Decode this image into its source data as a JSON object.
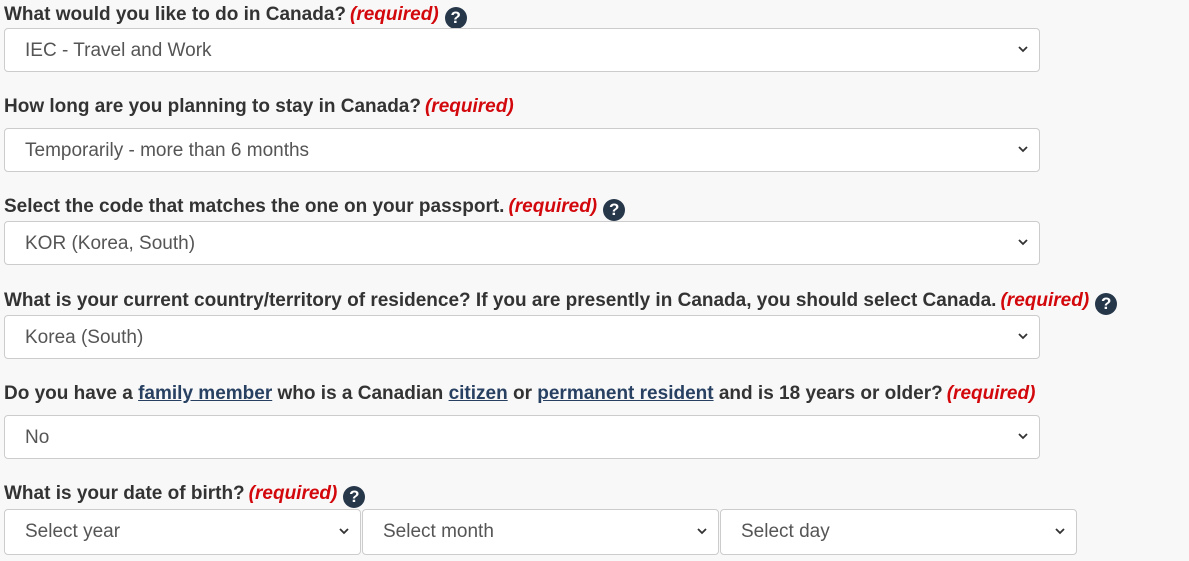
{
  "required_label": "(required)",
  "q1": {
    "label": "What would you like to do in Canada?",
    "value": "IEC - Travel and Work"
  },
  "q2": {
    "label": "How long are you planning to stay in Canada?",
    "value": "Temporarily - more than 6 months"
  },
  "q3": {
    "label": "Select the code that matches the one on your passport.",
    "value": "KOR (Korea, South)"
  },
  "q4": {
    "label": "What is your current country/territory of residence? If you are presently in Canada, you should select Canada.",
    "value": "Korea (South)"
  },
  "q5": {
    "pre": "Do you have a",
    "link1": "family member",
    "mid1": "who is a Canadian",
    "link2": "citizen",
    "mid2": "or",
    "link3": "permanent resident",
    "post": "and is 18 years or older?",
    "value": "No"
  },
  "q6": {
    "label": "What is your date of birth?",
    "year_placeholder": "Select year",
    "month_placeholder": "Select month",
    "day_placeholder": "Select day"
  },
  "help_glyph": "?",
  "colors": {
    "required": "#d3080c",
    "help_bg": "#26374a",
    "link": "#284162"
  }
}
